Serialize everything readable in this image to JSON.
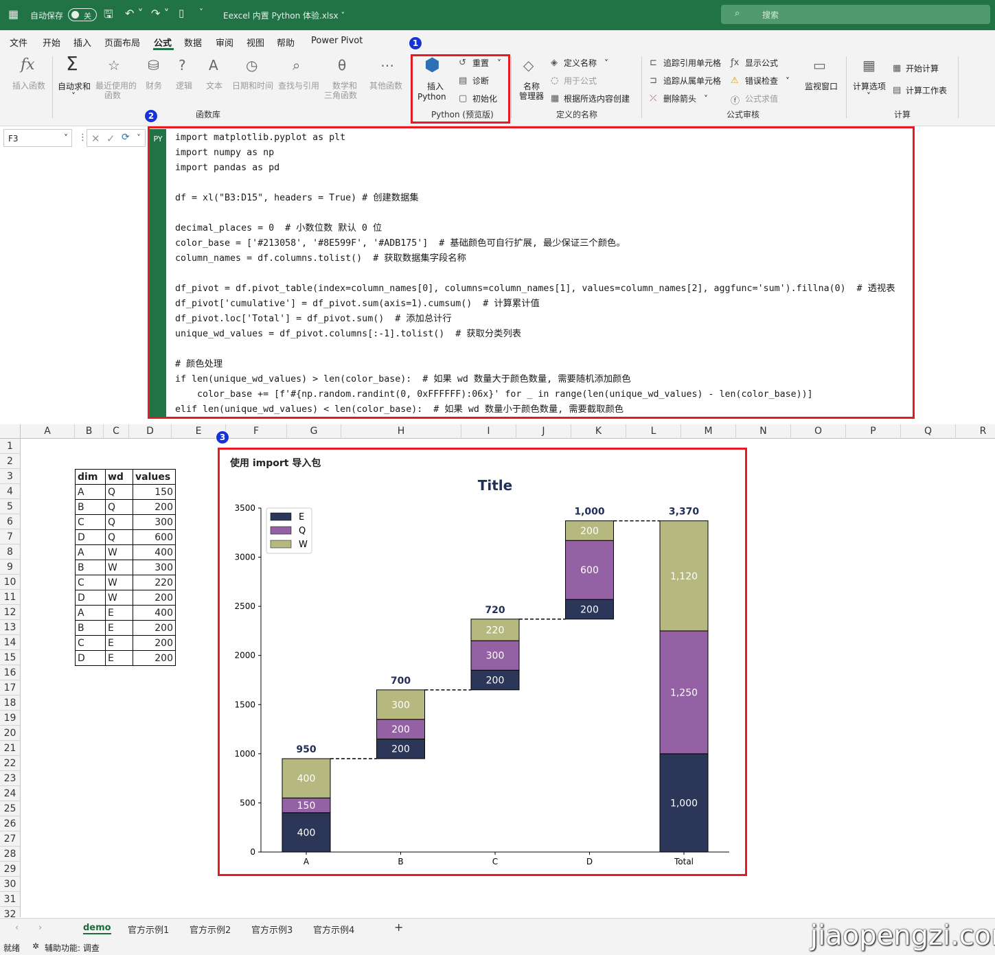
{
  "titlebar": {
    "autosave": "自动保存",
    "autosave_state": "关",
    "filename": "Eexcel 内置 Python 体验.xlsx",
    "search": "搜索"
  },
  "menu": [
    "文件",
    "开始",
    "插入",
    "页面布局",
    "公式",
    "数据",
    "审阅",
    "视图",
    "帮助",
    "Power Pivot"
  ],
  "ribbon": {
    "insert_function": "插入函数",
    "autosum": "自动求和",
    "recent": "最近使用的",
    "recent2": "函数",
    "financial": "财务",
    "logical": "逻辑",
    "text": "文本",
    "datetime": "日期和时间",
    "lookup": "查找与引用",
    "math": "数学和",
    "math2": "三角函数",
    "other": "其他函数",
    "function_library": "函数库",
    "insert_python": "插入",
    "insert_python2": "Python",
    "reset": "重置",
    "diagnose": "诊断",
    "initialize": "初始化",
    "python_group": "Python (预览版)",
    "name_manager": "名称",
    "name_manager2": "管理器",
    "define_name": "定义名称",
    "use_in_formula": "用于公式",
    "create_from_selection": "根据所选内容创建",
    "defined_names": "定义的名称",
    "trace_precedents": "追踪引用单元格",
    "trace_dependents": "追踪从属单元格",
    "remove_arrows": "删除箭头",
    "show_formulas": "显示公式",
    "error_checking": "错误检查",
    "evaluate_formula": "公式求值",
    "watch_window": "监视窗口",
    "formula_auditing": "公式审核",
    "calc_options": "计算选项",
    "calc_now": "开始计算",
    "calc_sheet": "计算工作表",
    "calculation": "计算"
  },
  "badges": [
    "1",
    "2",
    "3"
  ],
  "namebox": "F3",
  "py_badge": "PY",
  "code_lines": [
    "import matplotlib.pyplot as plt",
    "import numpy as np",
    "import pandas as pd",
    "",
    "df = xl(\"B3:D15\", headers = True) # 创建数据集",
    "",
    "decimal_places = 0  # 小数位数 默认 0 位",
    "color_base = ['#213058', '#8E599F', '#ADB175']  # 基础颜色可自行扩展, 最少保证三个颜色。",
    "column_names = df.columns.tolist()  # 获取数据集字段名称",
    "",
    "df_pivot = df.pivot_table(index=column_names[0], columns=column_names[1], values=column_names[2], aggfunc='sum').fillna(0)  # 透视表",
    "df_pivot['cumulative'] = df_pivot.sum(axis=1).cumsum()  # 计算累计值",
    "df_pivot.loc['Total'] = df_pivot.sum()  # 添加总计行",
    "unique_wd_values = df_pivot.columns[:-1].tolist()  # 获取分类列表",
    "",
    "# 颜色处理",
    "if len(unique_wd_values) > len(color_base):  # 如果 wd 数量大于颜色数量, 需要随机添加颜色",
    "    color_base += [f'#{np.random.randint(0, 0xFFFFFF):06x}' for _ in range(len(unique_wd_values) - len(color_base))]",
    "elif len(unique_wd_values) < len(color_base):  # 如果 wd 数量小于颜色数量, 需要截取颜色"
  ],
  "columns": [
    "A",
    "B",
    "C",
    "D",
    "E",
    "F",
    "G",
    "H",
    "I",
    "J",
    "K",
    "L",
    "M",
    "N",
    "O",
    "P",
    "Q",
    "R"
  ],
  "rows": [
    "1",
    "2",
    "3",
    "4",
    "5",
    "6",
    "7",
    "8",
    "9",
    "10",
    "11",
    "12",
    "13",
    "14",
    "15",
    "16",
    "17",
    "18",
    "19",
    "20",
    "21",
    "22",
    "23",
    "24",
    "25",
    "26",
    "27",
    "28",
    "29",
    "30",
    "31",
    "32"
  ],
  "table": {
    "headers": [
      "dim",
      "wd",
      "values"
    ],
    "rows": [
      [
        "A",
        "Q",
        "150"
      ],
      [
        "B",
        "Q",
        "200"
      ],
      [
        "C",
        "Q",
        "300"
      ],
      [
        "D",
        "Q",
        "600"
      ],
      [
        "A",
        "W",
        "400"
      ],
      [
        "B",
        "W",
        "300"
      ],
      [
        "C",
        "W",
        "220"
      ],
      [
        "D",
        "W",
        "200"
      ],
      [
        "A",
        "E",
        "400"
      ],
      [
        "B",
        "E",
        "200"
      ],
      [
        "C",
        "E",
        "200"
      ],
      [
        "D",
        "E",
        "200"
      ]
    ]
  },
  "chart_label": "使用 import 导入包",
  "chart_data": {
    "type": "bar",
    "title": "Title",
    "categories": [
      "A",
      "B",
      "C",
      "D",
      "Total"
    ],
    "series": [
      {
        "name": "E",
        "values": [
          400,
          200,
          200,
          200,
          1000
        ],
        "color": "#2b3659"
      },
      {
        "name": "Q",
        "values": [
          150,
          200,
          300,
          600,
          1250
        ],
        "color": "#9462a4"
      },
      {
        "name": "W",
        "values": [
          400,
          300,
          220,
          200,
          1120
        ],
        "color": "#b5b87f"
      }
    ],
    "base": [
      0,
      950,
      1650,
      2370,
      0
    ],
    "totals": [
      "950",
      "700",
      "720",
      "1,000",
      "3,370"
    ],
    "segment_labels": [
      [
        "400",
        "150",
        "400"
      ],
      [
        "200",
        "200",
        "300"
      ],
      [
        "200",
        "300",
        "220"
      ],
      [
        "200",
        "600",
        "200"
      ],
      [
        "1,000",
        "1,250",
        "1,120"
      ]
    ],
    "ylim": [
      0,
      3500
    ],
    "yticks": [
      "0",
      "500",
      "1000",
      "1500",
      "2000",
      "2500",
      "3000",
      "3500"
    ],
    "legend_position": "top-left",
    "grid": false
  },
  "sheet_tabs": [
    "demo",
    "官方示例1",
    "官方示例2",
    "官方示例3",
    "官方示例4"
  ],
  "add_sheet": "+",
  "status": {
    "ready": "就绪",
    "accessibility": "辅助功能: 调查"
  },
  "watermark": "jiaopengzi.com"
}
